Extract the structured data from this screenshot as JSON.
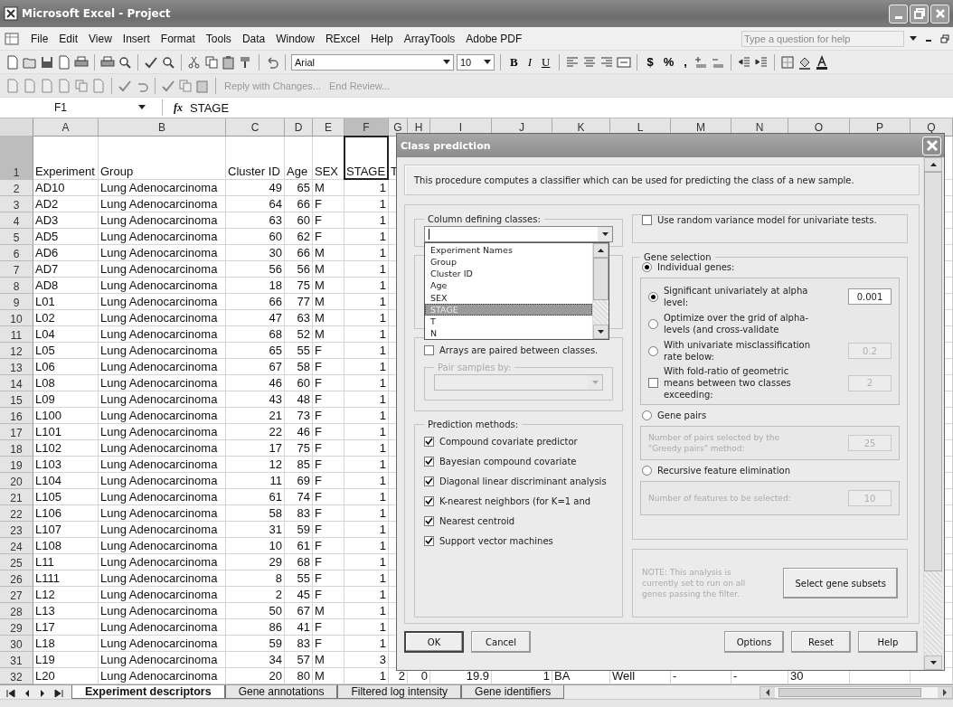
{
  "window": {
    "title": "Microsoft Excel - Project"
  },
  "menu": [
    "File",
    "Edit",
    "View",
    "Insert",
    "Format",
    "Tools",
    "Data",
    "Window",
    "RExcel",
    "Help",
    "ArrayTools",
    "Adobe PDF"
  ],
  "help_search": {
    "placeholder": "Type a question for help"
  },
  "formatting": {
    "font": "Arial",
    "size": "10",
    "style_buttons": [
      "B",
      "I",
      "U"
    ],
    "number_buttons": [
      "$",
      "%",
      ","
    ]
  },
  "review_toolbar": [
    "Reply with Changes...",
    "End Review..."
  ],
  "formula_bar": {
    "name_box": "F1",
    "function_label": "fx",
    "value": "STAGE"
  },
  "sheet": {
    "columns": [
      {
        "letter": "A",
        "selected": false
      },
      {
        "letter": "B",
        "selected": false
      },
      {
        "letter": "C",
        "selected": false
      },
      {
        "letter": "D",
        "selected": false
      },
      {
        "letter": "E",
        "selected": false
      },
      {
        "letter": "F",
        "selected": true
      },
      {
        "letter": "G",
        "selected": false
      },
      {
        "letter": "H",
        "selected": false
      },
      {
        "letter": "I",
        "selected": false
      },
      {
        "letter": "J",
        "selected": false
      },
      {
        "letter": "K",
        "selected": false
      },
      {
        "letter": "L",
        "selected": false
      },
      {
        "letter": "M",
        "selected": false
      },
      {
        "letter": "N",
        "selected": false
      },
      {
        "letter": "O",
        "selected": false
      },
      {
        "letter": "P",
        "selected": false
      },
      {
        "letter": "Q",
        "selected": false
      }
    ],
    "rows": [
      {
        "number": "1",
        "kind": "header",
        "selected": true,
        "cells": [
          "Experiment",
          "Group",
          "Cluster ID",
          "Age",
          "SEX",
          "STAGE",
          "T"
        ]
      },
      {
        "number": "2",
        "kind": "data",
        "selected": false,
        "cells": [
          "AD10",
          "Lung Adenocarcinoma",
          "49",
          "65",
          "M",
          "1"
        ]
      },
      {
        "number": "3",
        "kind": "data",
        "selected": false,
        "cells": [
          "AD2",
          "Lung Adenocarcinoma",
          "64",
          "66",
          "F",
          "1"
        ]
      },
      {
        "number": "4",
        "kind": "data",
        "selected": false,
        "cells": [
          "AD3",
          "Lung Adenocarcinoma",
          "63",
          "60",
          "F",
          "1"
        ]
      },
      {
        "number": "5",
        "kind": "data",
        "selected": false,
        "cells": [
          "AD5",
          "Lung Adenocarcinoma",
          "60",
          "62",
          "F",
          "1"
        ]
      },
      {
        "number": "6",
        "kind": "data",
        "selected": false,
        "cells": [
          "AD6",
          "Lung Adenocarcinoma",
          "30",
          "66",
          "M",
          "1"
        ]
      },
      {
        "number": "7",
        "kind": "data",
        "selected": false,
        "cells": [
          "AD7",
          "Lung Adenocarcinoma",
          "56",
          "56",
          "M",
          "1"
        ]
      },
      {
        "number": "8",
        "kind": "data",
        "selected": false,
        "cells": [
          "AD8",
          "Lung Adenocarcinoma",
          "18",
          "75",
          "M",
          "1"
        ]
      },
      {
        "number": "9",
        "kind": "data",
        "selected": false,
        "cells": [
          "L01",
          "Lung Adenocarcinoma",
          "66",
          "77",
          "M",
          "1"
        ]
      },
      {
        "number": "10",
        "kind": "data",
        "selected": false,
        "cells": [
          "L02",
          "Lung Adenocarcinoma",
          "47",
          "63",
          "M",
          "1"
        ]
      },
      {
        "number": "11",
        "kind": "data",
        "selected": false,
        "cells": [
          "L04",
          "Lung Adenocarcinoma",
          "68",
          "52",
          "M",
          "1"
        ]
      },
      {
        "number": "12",
        "kind": "data",
        "selected": false,
        "cells": [
          "L05",
          "Lung Adenocarcinoma",
          "65",
          "55",
          "F",
          "1"
        ]
      },
      {
        "number": "13",
        "kind": "data",
        "selected": false,
        "cells": [
          "L06",
          "Lung Adenocarcinoma",
          "67",
          "58",
          "F",
          "1"
        ]
      },
      {
        "number": "14",
        "kind": "data",
        "selected": false,
        "cells": [
          "L08",
          "Lung Adenocarcinoma",
          "46",
          "60",
          "F",
          "1"
        ]
      },
      {
        "number": "15",
        "kind": "data",
        "selected": false,
        "cells": [
          "L09",
          "Lung Adenocarcinoma",
          "43",
          "48",
          "F",
          "1"
        ]
      },
      {
        "number": "16",
        "kind": "data",
        "selected": false,
        "cells": [
          "L100",
          "Lung Adenocarcinoma",
          "21",
          "73",
          "F",
          "1"
        ]
      },
      {
        "number": "17",
        "kind": "data",
        "selected": false,
        "cells": [
          "L101",
          "Lung Adenocarcinoma",
          "22",
          "46",
          "F",
          "1"
        ]
      },
      {
        "number": "18",
        "kind": "data",
        "selected": false,
        "cells": [
          "L102",
          "Lung Adenocarcinoma",
          "17",
          "75",
          "F",
          "1"
        ]
      },
      {
        "number": "19",
        "kind": "data",
        "selected": false,
        "cells": [
          "L103",
          "Lung Adenocarcinoma",
          "12",
          "85",
          "F",
          "1"
        ]
      },
      {
        "number": "20",
        "kind": "data",
        "selected": false,
        "cells": [
          "L104",
          "Lung Adenocarcinoma",
          "11",
          "69",
          "F",
          "1"
        ]
      },
      {
        "number": "21",
        "kind": "data",
        "selected": false,
        "cells": [
          "L105",
          "Lung Adenocarcinoma",
          "61",
          "74",
          "F",
          "1"
        ]
      },
      {
        "number": "22",
        "kind": "data",
        "selected": false,
        "cells": [
          "L106",
          "Lung Adenocarcinoma",
          "58",
          "83",
          "F",
          "1"
        ]
      },
      {
        "number": "23",
        "kind": "data",
        "selected": false,
        "cells": [
          "L107",
          "Lung Adenocarcinoma",
          "31",
          "59",
          "F",
          "1"
        ]
      },
      {
        "number": "24",
        "kind": "data",
        "selected": false,
        "cells": [
          "L108",
          "Lung Adenocarcinoma",
          "10",
          "61",
          "F",
          "1"
        ]
      },
      {
        "number": "25",
        "kind": "data",
        "selected": false,
        "cells": [
          "L11",
          "Lung Adenocarcinoma",
          "29",
          "68",
          "F",
          "1"
        ]
      },
      {
        "number": "26",
        "kind": "data",
        "selected": false,
        "cells": [
          "L111",
          "Lung Adenocarcinoma",
          "8",
          "55",
          "F",
          "1"
        ]
      },
      {
        "number": "27",
        "kind": "data",
        "selected": false,
        "cells": [
          "L12",
          "Lung Adenocarcinoma",
          "2",
          "45",
          "F",
          "1"
        ]
      },
      {
        "number": "28",
        "kind": "data",
        "selected": false,
        "cells": [
          "L13",
          "Lung Adenocarcinoma",
          "50",
          "67",
          "M",
          "1"
        ]
      },
      {
        "number": "29",
        "kind": "data",
        "selected": false,
        "cells": [
          "L17",
          "Lung Adenocarcinoma",
          "86",
          "41",
          "F",
          "1"
        ]
      },
      {
        "number": "30",
        "kind": "data",
        "selected": false,
        "cells": [
          "L18",
          "Lung Adenocarcinoma",
          "59",
          "83",
          "F",
          "1"
        ]
      },
      {
        "number": "31",
        "kind": "data",
        "selected": false,
        "cells": [
          "L19",
          "Lung Adenocarcinoma",
          "34",
          "57",
          "M",
          "3"
        ]
      },
      {
        "number": "32",
        "kind": "data",
        "selected": false,
        "cells": [
          "L20",
          "Lung Adenocarcinoma",
          "20",
          "80",
          "M",
          "1",
          "2",
          "0",
          "19.9",
          "1",
          "BA",
          "Well",
          "-",
          "-",
          "30"
        ]
      }
    ]
  },
  "sheet_tabs": [
    {
      "label": "Experiment descriptors",
      "selected": true
    },
    {
      "label": "Gene annotations",
      "selected": false
    },
    {
      "label": "Filtered log intensity",
      "selected": false
    },
    {
      "label": "Gene identifiers",
      "selected": false
    }
  ],
  "dialog": {
    "title": "Class prediction",
    "description": "This procedure computes a classifier which can be used for predicting the class of a new sample.",
    "class_column": {
      "label": "Column defining classes:",
      "options": [
        {
          "label": "Experiment Names",
          "selected": false
        },
        {
          "label": "Group",
          "selected": false
        },
        {
          "label": "Cluster ID",
          "selected": false
        },
        {
          "label": "Age",
          "selected": false
        },
        {
          "label": "SEX",
          "selected": false
        },
        {
          "label": "STAGE",
          "selected": true
        },
        {
          "label": "T",
          "selected": false
        },
        {
          "label": "N",
          "selected": false
        }
      ]
    },
    "paired": {
      "label": "Arrays are paired between classes.",
      "checked": false
    },
    "pair_samples": {
      "label": "Pair samples by:",
      "disabled": true
    },
    "prediction_methods": {
      "label": "Prediction methods:",
      "items": [
        {
          "label": "Compound covariate predictor",
          "checked": true
        },
        {
          "label": "Bayesian compound covariate",
          "checked": true
        },
        {
          "label": "Diagonal linear discriminant analysis",
          "checked": true
        },
        {
          "label": "K-nearest neighbors  (for K=1 and",
          "checked": true
        },
        {
          "label": "Nearest centroid",
          "checked": true
        },
        {
          "label": "Support vector machines",
          "checked": true
        }
      ]
    },
    "random_variance": {
      "label": "Use random variance model for univariate tests.",
      "checked": false
    },
    "gene_selection": {
      "label": "Gene selection",
      "individual": {
        "label": "Individual genes:",
        "selected": true,
        "options": [
          {
            "kind": "radio",
            "label": "Significant univariately at alpha level:",
            "selected": true,
            "value": "0.001",
            "disabled": false
          },
          {
            "kind": "radio",
            "label": "Optimize over the grid of alpha-levels (and cross-validate",
            "selected": false
          },
          {
            "kind": "radio",
            "label": "With univariate  misclassification rate below:",
            "selected": false,
            "value": "0.2",
            "disabled": true
          },
          {
            "kind": "checkbox",
            "label": "With fold-ratio of geometric means between two classes exceeding:",
            "checked": false,
            "value": "2",
            "disabled": true
          }
        ]
      },
      "pairs": {
        "label": "Gene pairs",
        "selected": false,
        "setting": "Number of pairs selected by the \"Greedy pairs\" method:",
        "value": "25",
        "disabled": true
      },
      "recursive": {
        "label": "Recursive feature elimination",
        "selected": false,
        "setting": "Number of features to be selected:",
        "value": "10",
        "disabled": true
      }
    },
    "note": {
      "text": "NOTE:  This analysis is currently set to run on all genes passing the filter.",
      "button": "Select gene subsets"
    },
    "buttons_left": [
      {
        "label": "OK",
        "default": true
      },
      {
        "label": "Cancel",
        "default": false
      }
    ],
    "buttons_right": [
      {
        "label": "Options",
        "default": false
      },
      {
        "label": "Reset",
        "default": false
      },
      {
        "label": "Help",
        "default": false
      }
    ]
  }
}
